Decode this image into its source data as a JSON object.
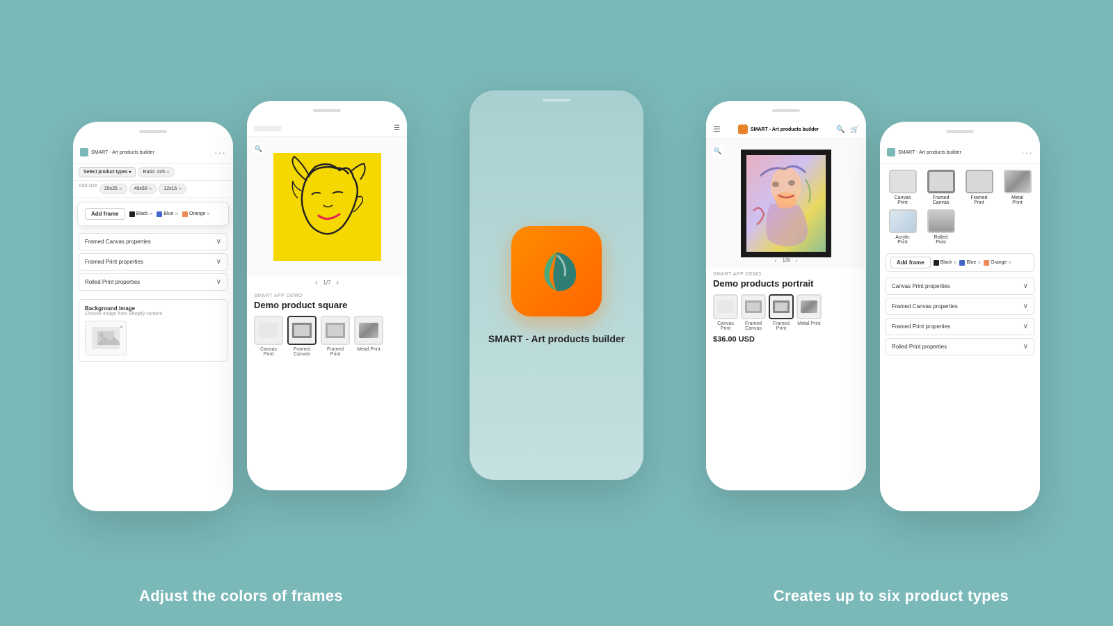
{
  "app": {
    "name": "SMART - Art products builder",
    "tagline": "SMART - Art products builder"
  },
  "captions": {
    "left": "Adjust the colors of  frames",
    "right": "Creates up to six product types"
  },
  "phone1": {
    "title": "SMART - Art products builder",
    "select_btn": "Select product types",
    "chips": [
      "Ratio: 4x5",
      "20x25",
      "40x50",
      "12x15"
    ],
    "add_frame_btn": "Add frame",
    "frame_colors": [
      "Black",
      "Blue",
      "Orange"
    ],
    "properties": [
      "Framed Canvas properties",
      "Framed Print properties",
      "Rolled Print properties"
    ],
    "bg_section_title": "Background image",
    "bg_section_sub": "Choose image from Shopify content"
  },
  "phone2": {
    "demo_label": "SMART APP DEMO",
    "product_title": "Demo product square",
    "pagination": "1/7",
    "types": [
      {
        "label": "Canvas Print",
        "selected": false
      },
      {
        "label": "Framed Canvas",
        "selected": true
      },
      {
        "label": "Framed Print",
        "selected": false
      },
      {
        "label": "Metal Print",
        "selected": false
      }
    ]
  },
  "center_phone": {
    "app_name": "SMART - Art products builder"
  },
  "phone3": {
    "demo_label": "SMART APP DEMO",
    "product_title": "Demo products portrait",
    "pagination": "1/9",
    "price": "$36.00 USD",
    "types": [
      {
        "label": "Canvas Print",
        "selected": false
      },
      {
        "label": "Framed Canvas",
        "selected": false
      },
      {
        "label": "Framed Print",
        "selected": true
      },
      {
        "label": "Metal Print",
        "selected": false
      }
    ]
  },
  "phone4": {
    "title": "SMART - Art products builder",
    "types": [
      {
        "label": "Canvas Print",
        "selected": false
      },
      {
        "label": "Framed Canvas",
        "selected": true
      },
      {
        "label": "Framed Print",
        "selected": false
      },
      {
        "label": "Metal Print",
        "selected": false
      },
      {
        "label": "Acrylic Print",
        "selected": false
      },
      {
        "label": "Rolled Print",
        "selected": false
      }
    ],
    "frame_add_btn": "Add frame",
    "frame_colors": [
      "Black",
      "Blue",
      "Orange"
    ],
    "properties": [
      "Canvas Print properties",
      "Framed Canvas properties",
      "Framed Print properties",
      "Rolled Print properties"
    ]
  },
  "icons": {
    "dots": "···",
    "chevron_down": "∨",
    "zoom": "🔍",
    "menu": "☰",
    "search": "🔍",
    "cart": "🛒",
    "left_arrow": "‹",
    "right_arrow": "›",
    "close": "×"
  }
}
